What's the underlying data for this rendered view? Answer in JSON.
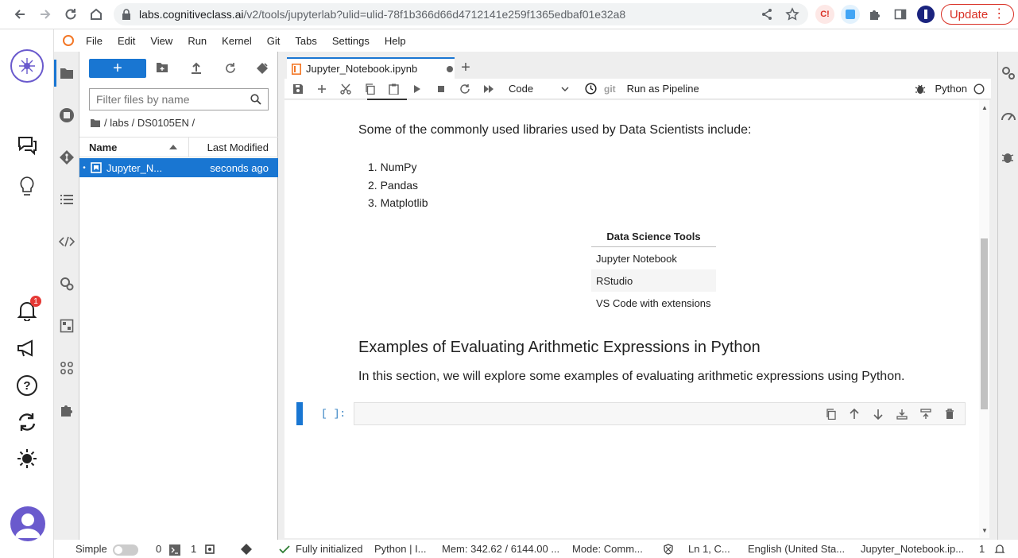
{
  "browser": {
    "url_host": "labs.cognitiveclass.ai",
    "url_path": "/v2/tools/jupyterlab?ulid=ulid-78f1b366d66d4712141e259f1365edbaf01e32a8",
    "update_label": "Update",
    "ext_badge": "C!"
  },
  "rail": {
    "notification_count": "1"
  },
  "menu": [
    "File",
    "Edit",
    "View",
    "Run",
    "Kernel",
    "Git",
    "Tabs",
    "Settings",
    "Help"
  ],
  "filebrowser": {
    "new_label": "+",
    "filter_placeholder": "Filter files by name",
    "breadcrumb": "/ labs / DS0105EN /",
    "col_name": "Name",
    "col_modified": "Last Modified",
    "file_name": "Jupyter_N...",
    "file_modified": "seconds ago"
  },
  "tabs": {
    "active_label": "Jupyter_Notebook.ipynb"
  },
  "toolbar": {
    "cell_type": "Code",
    "git_label": "git",
    "pipeline_label": "Run as Pipeline",
    "kernel_name": "Python"
  },
  "notebook": {
    "intro": "Some of the commonly used libraries used by Data Scientists include:",
    "libraries": [
      "NumPy",
      "Pandas",
      "Matplotlib"
    ],
    "table_header": "Data Science Tools",
    "table_rows": [
      "Jupyter Notebook",
      "RStudio",
      "VS Code with extensions"
    ],
    "heading": "Examples of Evaluating Arithmetic Expressions in Python",
    "paragraph": "In this section, we will explore some examples of evaluating arithmetic expressions using Python.",
    "prompt": "[ ]:"
  },
  "status": {
    "mode": "Simple",
    "terminals": "0",
    "kernels": "1",
    "kernel_state": "Fully initialized",
    "kernel_name": "Python | I...",
    "memory": "Mem: 342.62 / 6144.00 ...",
    "cmd_mode": "Mode: Comm...",
    "cursor": "Ln 1, C...",
    "language": "English (United Sta...",
    "file": "Jupyter_Notebook.ip...",
    "count": "1"
  },
  "colors": {
    "accent": "#1976d2",
    "update_red": "#d93025",
    "notify_red": "#e53935"
  }
}
